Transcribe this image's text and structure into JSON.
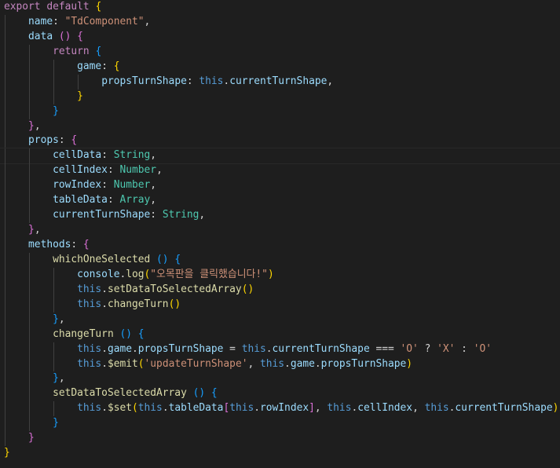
{
  "editor": {
    "language": "javascript",
    "current_line": 11,
    "lines": [
      {
        "indent": 0,
        "tokens": [
          {
            "t": "export",
            "c": "kw"
          },
          {
            "t": " ",
            "c": "punc"
          },
          {
            "t": "default",
            "c": "kw"
          },
          {
            "t": " ",
            "c": "punc"
          },
          {
            "t": "{",
            "c": "b1"
          }
        ]
      },
      {
        "indent": 1,
        "tokens": [
          {
            "t": "name",
            "c": "prop"
          },
          {
            "t": ": ",
            "c": "punc"
          },
          {
            "t": "\"TdComponent\"",
            "c": "str"
          },
          {
            "t": ",",
            "c": "punc"
          }
        ]
      },
      {
        "indent": 1,
        "tokens": [
          {
            "t": "data",
            "c": "prop"
          },
          {
            "t": " ",
            "c": "punc"
          },
          {
            "t": "()",
            "c": "b2"
          },
          {
            "t": " ",
            "c": "punc"
          },
          {
            "t": "{",
            "c": "b2"
          }
        ]
      },
      {
        "indent": 2,
        "tokens": [
          {
            "t": "return",
            "c": "ctl"
          },
          {
            "t": " ",
            "c": "punc"
          },
          {
            "t": "{",
            "c": "b3"
          }
        ]
      },
      {
        "indent": 3,
        "tokens": [
          {
            "t": "game",
            "c": "prop"
          },
          {
            "t": ": ",
            "c": "punc"
          },
          {
            "t": "{",
            "c": "b1"
          }
        ]
      },
      {
        "indent": 4,
        "tokens": [
          {
            "t": "propsTurnShape",
            "c": "prop"
          },
          {
            "t": ": ",
            "c": "punc"
          },
          {
            "t": "this",
            "c": "this"
          },
          {
            "t": ".",
            "c": "punc"
          },
          {
            "t": "currentTurnShape",
            "c": "prop"
          },
          {
            "t": ",",
            "c": "punc"
          }
        ]
      },
      {
        "indent": 3,
        "tokens": [
          {
            "t": "}",
            "c": "b1"
          }
        ]
      },
      {
        "indent": 2,
        "tokens": [
          {
            "t": "}",
            "c": "b3"
          }
        ]
      },
      {
        "indent": 1,
        "tokens": [
          {
            "t": "}",
            "c": "b2"
          },
          {
            "t": ",",
            "c": "punc"
          }
        ]
      },
      {
        "indent": 1,
        "tokens": [
          {
            "t": "props",
            "c": "prop"
          },
          {
            "t": ": ",
            "c": "punc"
          },
          {
            "t": "{",
            "c": "b2"
          }
        ]
      },
      {
        "indent": 2,
        "tokens": [
          {
            "t": "cellData",
            "c": "prop"
          },
          {
            "t": ": ",
            "c": "punc"
          },
          {
            "t": "String",
            "c": "type"
          },
          {
            "t": ",",
            "c": "punc"
          }
        ]
      },
      {
        "indent": 2,
        "tokens": [
          {
            "t": "cellIndex",
            "c": "prop"
          },
          {
            "t": ": ",
            "c": "punc"
          },
          {
            "t": "Number",
            "c": "type"
          },
          {
            "t": ",",
            "c": "punc"
          }
        ]
      },
      {
        "indent": 2,
        "tokens": [
          {
            "t": "rowIndex",
            "c": "prop"
          },
          {
            "t": ": ",
            "c": "punc"
          },
          {
            "t": "Number",
            "c": "type"
          },
          {
            "t": ",",
            "c": "punc"
          }
        ]
      },
      {
        "indent": 2,
        "tokens": [
          {
            "t": "tableData",
            "c": "prop"
          },
          {
            "t": ": ",
            "c": "punc"
          },
          {
            "t": "Array",
            "c": "type"
          },
          {
            "t": ",",
            "c": "punc"
          }
        ]
      },
      {
        "indent": 2,
        "tokens": [
          {
            "t": "currentTurnShape",
            "c": "prop"
          },
          {
            "t": ": ",
            "c": "punc"
          },
          {
            "t": "String",
            "c": "type"
          },
          {
            "t": ",",
            "c": "punc"
          }
        ]
      },
      {
        "indent": 1,
        "tokens": [
          {
            "t": "}",
            "c": "b2"
          },
          {
            "t": ",",
            "c": "punc"
          }
        ]
      },
      {
        "indent": 1,
        "tokens": [
          {
            "t": "methods",
            "c": "prop"
          },
          {
            "t": ": ",
            "c": "punc"
          },
          {
            "t": "{",
            "c": "b2"
          }
        ]
      },
      {
        "indent": 2,
        "tokens": [
          {
            "t": "whichOneSelected",
            "c": "fn"
          },
          {
            "t": " ",
            "c": "punc"
          },
          {
            "t": "()",
            "c": "b3"
          },
          {
            "t": " ",
            "c": "punc"
          },
          {
            "t": "{",
            "c": "b3"
          }
        ]
      },
      {
        "indent": 3,
        "tokens": [
          {
            "t": "console",
            "c": "prop"
          },
          {
            "t": ".",
            "c": "punc"
          },
          {
            "t": "log",
            "c": "fn"
          },
          {
            "t": "(",
            "c": "b1"
          },
          {
            "t": "\"오목판을 클릭했습니다!\"",
            "c": "str"
          },
          {
            "t": ")",
            "c": "b1"
          }
        ]
      },
      {
        "indent": 3,
        "tokens": [
          {
            "t": "this",
            "c": "this"
          },
          {
            "t": ".",
            "c": "punc"
          },
          {
            "t": "setDataToSelectedArray",
            "c": "fn"
          },
          {
            "t": "()",
            "c": "b1"
          }
        ]
      },
      {
        "indent": 3,
        "tokens": [
          {
            "t": "this",
            "c": "this"
          },
          {
            "t": ".",
            "c": "punc"
          },
          {
            "t": "changeTurn",
            "c": "fn"
          },
          {
            "t": "()",
            "c": "b1"
          }
        ]
      },
      {
        "indent": 2,
        "tokens": [
          {
            "t": "}",
            "c": "b3"
          },
          {
            "t": ",",
            "c": "punc"
          }
        ]
      },
      {
        "indent": 2,
        "tokens": [
          {
            "t": "changeTurn",
            "c": "fn"
          },
          {
            "t": " ",
            "c": "punc"
          },
          {
            "t": "()",
            "c": "b3"
          },
          {
            "t": " ",
            "c": "punc"
          },
          {
            "t": "{",
            "c": "b3"
          }
        ]
      },
      {
        "indent": 3,
        "tokens": [
          {
            "t": "this",
            "c": "this"
          },
          {
            "t": ".",
            "c": "punc"
          },
          {
            "t": "game",
            "c": "prop"
          },
          {
            "t": ".",
            "c": "punc"
          },
          {
            "t": "propsTurnShape",
            "c": "prop"
          },
          {
            "t": " = ",
            "c": "op"
          },
          {
            "t": "this",
            "c": "this"
          },
          {
            "t": ".",
            "c": "punc"
          },
          {
            "t": "currentTurnShape",
            "c": "prop"
          },
          {
            "t": " === ",
            "c": "op"
          },
          {
            "t": "'O'",
            "c": "str"
          },
          {
            "t": " ? ",
            "c": "op"
          },
          {
            "t": "'X'",
            "c": "str"
          },
          {
            "t": " : ",
            "c": "op"
          },
          {
            "t": "'O'",
            "c": "str"
          }
        ]
      },
      {
        "indent": 3,
        "tokens": [
          {
            "t": "this",
            "c": "this"
          },
          {
            "t": ".",
            "c": "punc"
          },
          {
            "t": "$emit",
            "c": "fn"
          },
          {
            "t": "(",
            "c": "b1"
          },
          {
            "t": "'updateTurnShape'",
            "c": "str"
          },
          {
            "t": ", ",
            "c": "punc"
          },
          {
            "t": "this",
            "c": "this"
          },
          {
            "t": ".",
            "c": "punc"
          },
          {
            "t": "game",
            "c": "prop"
          },
          {
            "t": ".",
            "c": "punc"
          },
          {
            "t": "propsTurnShape",
            "c": "prop"
          },
          {
            "t": ")",
            "c": "b1"
          }
        ]
      },
      {
        "indent": 2,
        "tokens": [
          {
            "t": "}",
            "c": "b3"
          },
          {
            "t": ",",
            "c": "punc"
          }
        ]
      },
      {
        "indent": 2,
        "tokens": [
          {
            "t": "setDataToSelectedArray",
            "c": "fn"
          },
          {
            "t": " ",
            "c": "punc"
          },
          {
            "t": "()",
            "c": "b3"
          },
          {
            "t": " ",
            "c": "punc"
          },
          {
            "t": "{",
            "c": "b3"
          }
        ]
      },
      {
        "indent": 3,
        "tokens": [
          {
            "t": "this",
            "c": "this"
          },
          {
            "t": ".",
            "c": "punc"
          },
          {
            "t": "$set",
            "c": "fn"
          },
          {
            "t": "(",
            "c": "b1"
          },
          {
            "t": "this",
            "c": "this"
          },
          {
            "t": ".",
            "c": "punc"
          },
          {
            "t": "tableData",
            "c": "prop"
          },
          {
            "t": "[",
            "c": "b2"
          },
          {
            "t": "this",
            "c": "this"
          },
          {
            "t": ".",
            "c": "punc"
          },
          {
            "t": "rowIndex",
            "c": "prop"
          },
          {
            "t": "]",
            "c": "b2"
          },
          {
            "t": ", ",
            "c": "punc"
          },
          {
            "t": "this",
            "c": "this"
          },
          {
            "t": ".",
            "c": "punc"
          },
          {
            "t": "cellIndex",
            "c": "prop"
          },
          {
            "t": ", ",
            "c": "punc"
          },
          {
            "t": "this",
            "c": "this"
          },
          {
            "t": ".",
            "c": "punc"
          },
          {
            "t": "currentTurnShape",
            "c": "prop"
          },
          {
            "t": ")",
            "c": "b1"
          }
        ]
      },
      {
        "indent": 2,
        "tokens": [
          {
            "t": "}",
            "c": "b3"
          }
        ]
      },
      {
        "indent": 1,
        "tokens": [
          {
            "t": "}",
            "c": "b2"
          }
        ]
      },
      {
        "indent": 0,
        "tokens": [
          {
            "t": "}",
            "c": "b1"
          }
        ]
      }
    ]
  }
}
